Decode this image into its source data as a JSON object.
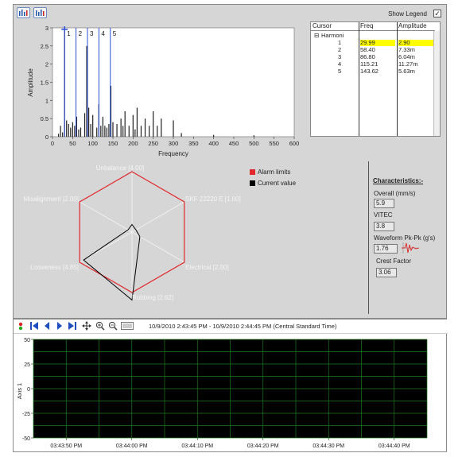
{
  "toolbar": {
    "show_legend_label": "Show Legend",
    "show_legend_checked": "✓"
  },
  "spectrum": {
    "xlabel": "Frequency",
    "ylabel": "Amplitude",
    "x_ticks": [
      "0",
      "50",
      "100",
      "150",
      "200",
      "250",
      "300",
      "350",
      "400",
      "450",
      "500",
      "550",
      "600"
    ],
    "y_ticks": [
      "3",
      "2.5",
      "2",
      "1.5",
      "1",
      "0.5",
      "0"
    ],
    "cursor_labels": [
      "1",
      "2",
      "3",
      "4",
      "5"
    ]
  },
  "cursor_table": {
    "headers": [
      "Cursor",
      "Freq",
      "Amplitude"
    ],
    "group_label": "Harmoni",
    "rows": [
      {
        "cursor": "1",
        "freq": "29.99",
        "amp": "2.90"
      },
      {
        "cursor": "2",
        "freq": "58.40",
        "amp": "7.33m"
      },
      {
        "cursor": "3",
        "freq": "86.80",
        "amp": "6.04m"
      },
      {
        "cursor": "4",
        "freq": "115.21",
        "amp": "11.27m"
      },
      {
        "cursor": "5",
        "freq": "143.62",
        "amp": "5.63m"
      }
    ]
  },
  "radar": {
    "axis_labels": [
      "Unbalance [4.00]",
      "SKF 22220 E [1.00]",
      "Electrical [2.00]",
      "Rubbing [2.62]",
      "Looseness [4.85]",
      "Misalignment [2.00]"
    ],
    "alarm_values": [
      4.0,
      4.0,
      4.0,
      4.0,
      4.0,
      4.0
    ],
    "current_values": [
      0.5,
      0.3,
      0.6,
      4.5,
      3.7,
      0.3
    ],
    "max": 4.0,
    "legend": [
      "Alarm limits",
      "Current value"
    ],
    "colors": {
      "alarm": "#e0282d",
      "current": "#000000"
    }
  },
  "characteristics": {
    "title": "Characteristics:-",
    "overall_label": "Overall (mm/s)",
    "overall_value": "5.9",
    "vitec_label": "VITEC",
    "vitec_value": "3.8",
    "waveform_label": "Waveform Pk-Pk (g's)",
    "waveform_value": "1.76",
    "crest_label": "Crest Factor",
    "crest_value": "3.06"
  },
  "nav": {
    "time_range": "10/9/2010 2:43:45 PM - 10/9/2010 2:44:45 PM (Central Standard Time)"
  },
  "timeplot": {
    "ylabel": "Axis 1",
    "y_ticks": [
      "50",
      "25",
      "0",
      "-25",
      "-50"
    ],
    "x_ticks": [
      "03:43:50 PM",
      "03:44:00 PM",
      "03:44:10 PM",
      "03:44:20 PM",
      "03:44:30 PM",
      "03:44:40 PM"
    ],
    "background": "#000000",
    "grid_color": "#1f7a1f"
  },
  "chart_data": {
    "type": "bar",
    "title": "",
    "xlabel": "Frequency",
    "ylabel": "Amplitude",
    "xlim": [
      0,
      600
    ],
    "ylim": [
      0,
      3
    ],
    "x": [
      15,
      20,
      25,
      30,
      35,
      40,
      45,
      50,
      55,
      60,
      65,
      70,
      80,
      85,
      90,
      95,
      100,
      110,
      115,
      120,
      125,
      130,
      135,
      140,
      145,
      150,
      160,
      170,
      175,
      180,
      190,
      200,
      205,
      210,
      220,
      230,
      240,
      250,
      260,
      270,
      300,
      320,
      400,
      500
    ],
    "values": [
      0.08,
      0.3,
      0.12,
      2.9,
      0.45,
      0.35,
      0.25,
      0.4,
      0.3,
      0.55,
      0.2,
      0.25,
      0.65,
      2.5,
      0.8,
      0.35,
      0.6,
      0.25,
      0.9,
      0.3,
      0.55,
      0.3,
      0.25,
      0.35,
      1.4,
      0.4,
      0.35,
      0.5,
      0.3,
      0.7,
      0.3,
      0.6,
      0.2,
      0.8,
      0.3,
      0.5,
      0.3,
      0.7,
      0.3,
      0.5,
      0.45,
      0.1,
      0.05,
      0.04
    ]
  }
}
